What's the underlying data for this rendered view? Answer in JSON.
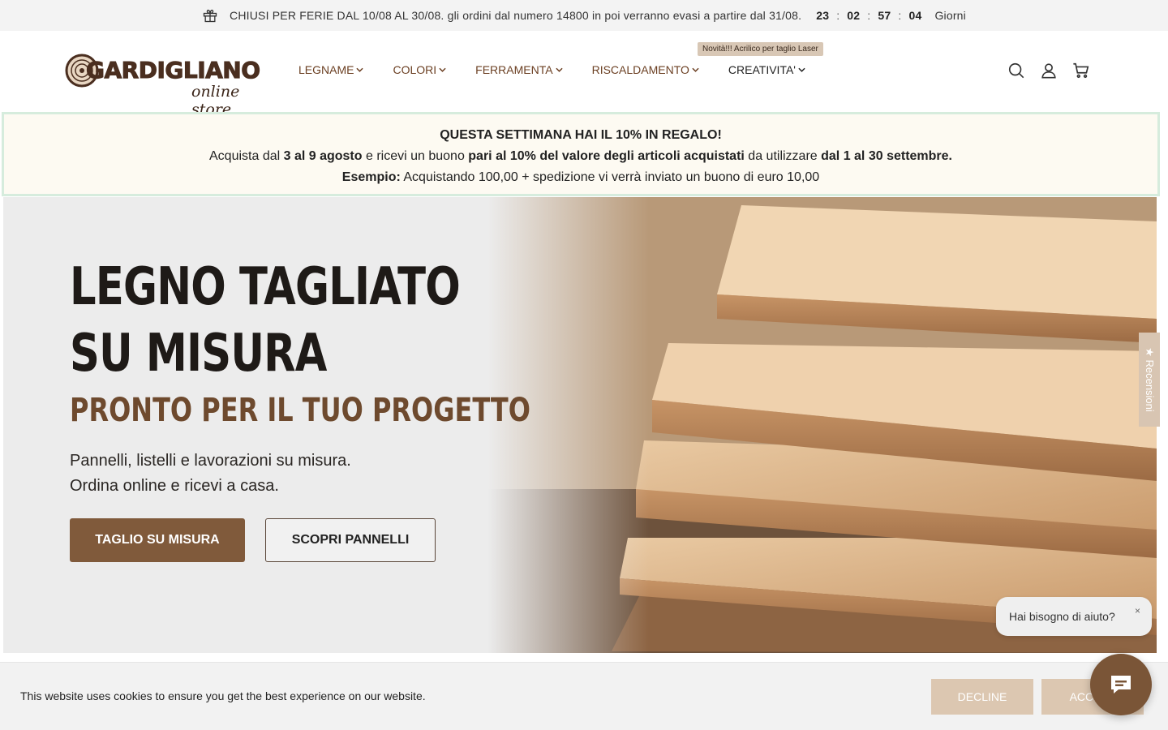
{
  "topbar": {
    "message": "CHIUSI PER FERIE DAL 10/08 AL 30/08. gli ordini dal numero 14800 in poi verranno evasi a partire dal 31/08.",
    "countdown": [
      "23",
      "02",
      "57",
      "04"
    ],
    "separator": ":",
    "days_label": "Giorni",
    "icon": "gift-icon"
  },
  "header": {
    "logo_text": "GARDIGLIANO",
    "logo_sub": "online store",
    "nav": [
      {
        "label": "LEGNAME"
      },
      {
        "label": "COLORI"
      },
      {
        "label": "FERRAMENTA"
      },
      {
        "label": "RISCALDAMENTO"
      },
      {
        "label": "CREATIVITA'"
      }
    ],
    "nav_badge": "Novità!!! Acrilico per taglio Laser",
    "icons": [
      "search-icon",
      "account-icon",
      "cart-icon"
    ]
  },
  "promo": {
    "title": "QUESTA SETTIMANA HAI IL 10% IN REGALO!",
    "line2_a": "Acquista dal ",
    "line2_b": "3 al 9 agosto",
    "line2_c": " e ricevi un buono ",
    "line2_d": "pari al 10% del valore degli articoli acquistati",
    "line2_e": " da utilizzare ",
    "line2_f": "dal 1 al 30 settembre.",
    "line3_label": "Esempio:",
    "line3_text": " Acquistando 100,00 + spedizione vi verrà inviato un buono di euro 10,00"
  },
  "hero": {
    "title_line1": "LEGNO TAGLIATO",
    "title_line2": "SU MISURA",
    "subtitle": "PRONTO PER IL TUO PROGETTO",
    "desc_line1": "Pannelli, listelli e lavorazioni su misura.",
    "desc_line2": "Ordina online e ricevi a casa.",
    "primary_button": "TAGLIO SU MISURA",
    "secondary_button": "SCOPRI PANNELLI"
  },
  "reviews_tab": "★ Recensioni",
  "help_bubble": {
    "text": "Hai bisogno di aiuto?",
    "close": "×"
  },
  "cookie": {
    "text": "This website uses cookies to ensure you get the best experience on our website.",
    "decline": "DECLINE",
    "accept": "ACCEPT"
  },
  "colors": {
    "brand": "#805a3b",
    "nav_text": "#6b3f22",
    "cookie_button": "#dcc7b1"
  }
}
